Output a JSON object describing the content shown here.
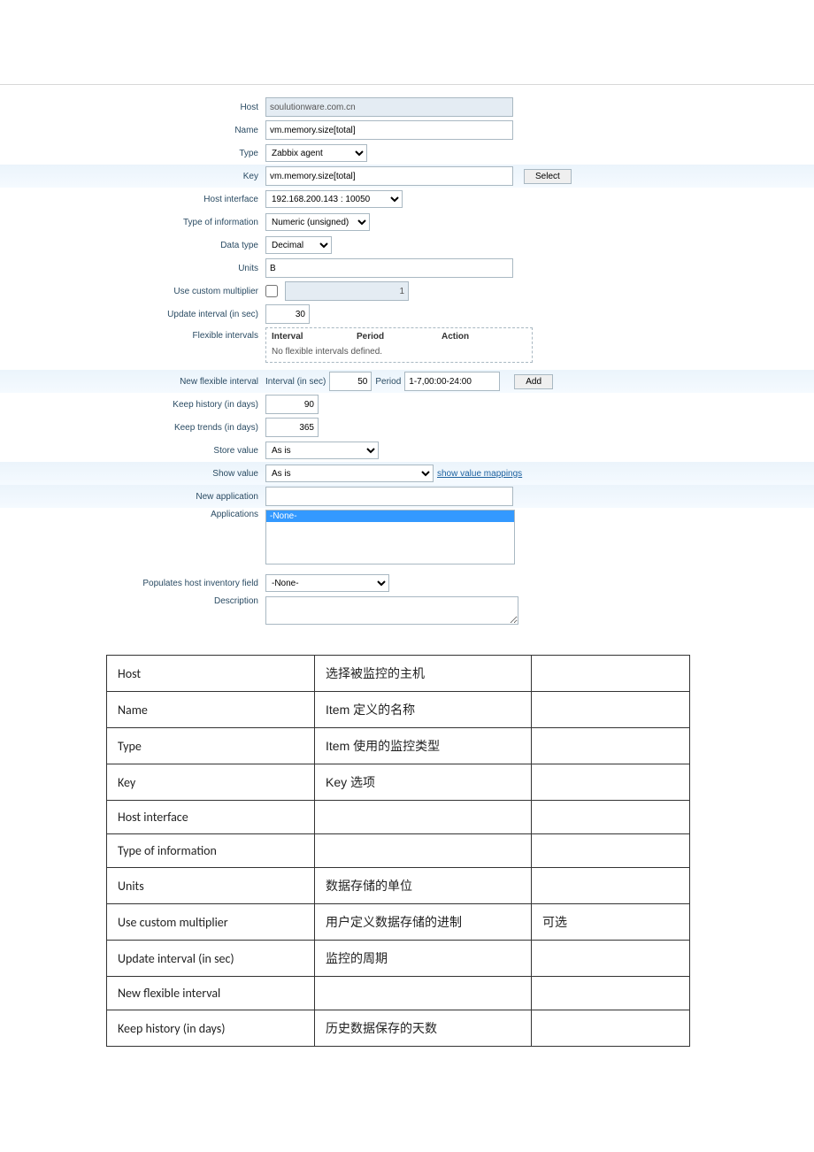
{
  "labels": {
    "host": "Host",
    "name": "Name",
    "type": "Type",
    "key": "Key",
    "host_interface": "Host interface",
    "type_of_information": "Type of information",
    "data_type": "Data type",
    "units": "Units",
    "use_custom_multiplier": "Use custom multiplier",
    "update_interval": "Update interval (in sec)",
    "flexible_intervals": "Flexible intervals",
    "new_flexible_interval": "New flexible interval",
    "keep_history": "Keep history (in days)",
    "keep_trends": "Keep trends (in days)",
    "store_value": "Store value",
    "show_value": "Show value",
    "new_application": "New application",
    "applications": "Applications",
    "populates_inventory": "Populates host inventory field",
    "description": "Description"
  },
  "values": {
    "host": "soulutionware.com.cn",
    "name": "vm.memory.size[total]",
    "type": "Zabbix agent",
    "key": "vm.memory.size[total]",
    "host_interface": "192.168.200.143 : 10050",
    "type_of_information": "Numeric (unsigned)",
    "data_type": "Decimal",
    "units": "B",
    "custom_multiplier": "1",
    "update_interval": "30",
    "new_flex_interval_sec": "50",
    "new_flex_period": "1-7,00:00-24:00",
    "keep_history": "90",
    "keep_trends": "365",
    "store_value": "As is",
    "show_value": "As is",
    "new_application": "",
    "applications_selected": "-None-",
    "populates_inventory": "-None-",
    "description": ""
  },
  "flex_table": {
    "headers": {
      "interval": "Interval",
      "period": "Period",
      "action": "Action"
    },
    "empty_text": "No flexible intervals defined."
  },
  "inline": {
    "interval_label": "Interval (in sec)",
    "period_label": "Period"
  },
  "buttons": {
    "select": "Select",
    "add": "Add"
  },
  "links": {
    "show_value_mappings": "show value mappings"
  },
  "desc_table": {
    "rows": [
      {
        "field": "Host",
        "desc": "选择被监控的主机",
        "note": ""
      },
      {
        "field": "Name",
        "desc": "Item 定义的名称",
        "note": ""
      },
      {
        "field": "Type",
        "desc": "Item 使用的监控类型",
        "note": ""
      },
      {
        "field": "Key",
        "desc": "Key 选项",
        "note": ""
      },
      {
        "field": "Host interface",
        "desc": "",
        "note": ""
      },
      {
        "field": "Type of information",
        "desc": "",
        "note": ""
      },
      {
        "field": "Units",
        "desc": "数据存储的单位",
        "note": ""
      },
      {
        "field": "Use custom multiplier",
        "desc": "用户定义数据存储的进制",
        "note": "可选"
      },
      {
        "field": "Update interval (in sec)",
        "desc": "监控的周期",
        "note": ""
      },
      {
        "field": "New flexible interval",
        "desc": "",
        "note": ""
      },
      {
        "field": "Keep history (in days)",
        "desc": "历史数据保存的天数",
        "note": ""
      }
    ]
  }
}
